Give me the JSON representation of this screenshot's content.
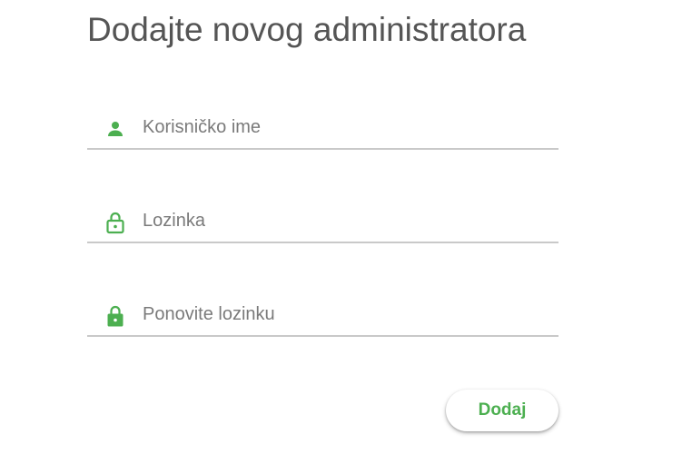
{
  "page": {
    "title": "Dodajte novog administratora"
  },
  "form": {
    "username": {
      "placeholder": "Korisničko ime",
      "value": "",
      "icon": "person-icon"
    },
    "password": {
      "placeholder": "Lozinka",
      "value": "",
      "icon": "lock-open-icon"
    },
    "confirm_password": {
      "placeholder": "Ponovite lozinku",
      "value": "",
      "icon": "lock-icon"
    },
    "submit_label": "Dodaj"
  },
  "colors": {
    "accent": "#4caf50",
    "title": "#555555",
    "underline": "#c9c9c9",
    "placeholder": "#7a7a7a"
  }
}
